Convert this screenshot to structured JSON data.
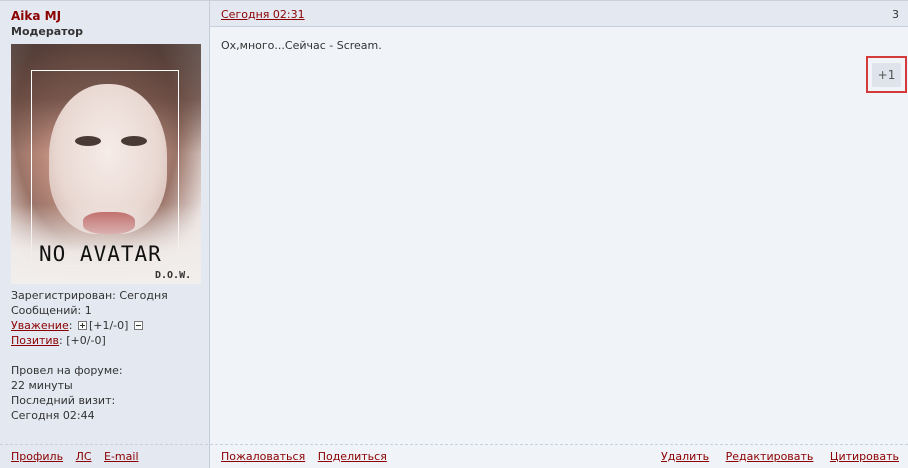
{
  "author": {
    "name": "Aika MJ",
    "role": "Модератор",
    "avatar_text": "NO AVATAR",
    "avatar_signature": "D.O.W."
  },
  "stats": {
    "registered_label": "Зарегистрирован:",
    "registered_value": "Сегодня",
    "messages_label": "Сообщений:",
    "messages_value": "1",
    "respect_label": "Уважение",
    "respect_value": "[+1/-0]",
    "positive_label": "Позитив",
    "positive_value": "[+0/-0]",
    "time_on_forum_label": "Провел на форуме:",
    "time_on_forum_value": "22 минуты",
    "last_visit_label": "Последний визит:",
    "last_visit_value": "Сегодня 02:44"
  },
  "profile_links": {
    "profile": "Профиль",
    "pm": "ЛС",
    "email": "E-mail"
  },
  "post": {
    "date": "Сегодня 02:31",
    "number": "3",
    "text": "Ох,много...Сейчас - Scream.",
    "plus_one": "+1"
  },
  "post_actions": {
    "report": "Пожаловаться",
    "share": "Поделиться",
    "delete": "Удалить",
    "edit": "Редактировать",
    "quote": "Цитировать"
  },
  "colors": {
    "link": "#8b0000",
    "left_bg": "#e3e8f1",
    "right_bg": "#f0f3f8",
    "highlight_border": "#d43a3a"
  }
}
